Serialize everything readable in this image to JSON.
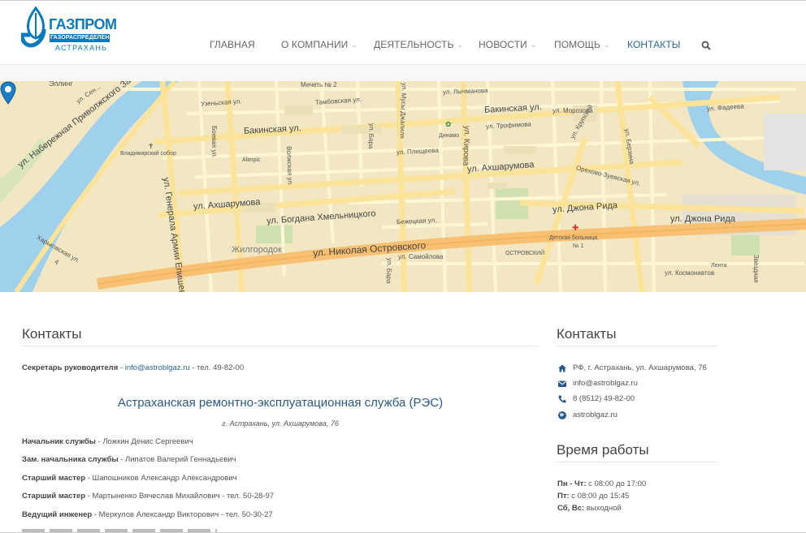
{
  "logo": {
    "word": "ГАЗПРОМ",
    "sub1": "ГАЗОРАСПРЕДЕЛЕНИЕ",
    "sub2": "АСТРАХАНЬ"
  },
  "nav": {
    "items": [
      {
        "label": "ГЛАВНАЯ",
        "dropdown": false
      },
      {
        "label": "О КОМПАНИИ",
        "dropdown": true
      },
      {
        "label": "ДЕЯТЕЛЬНОСТЬ",
        "dropdown": true
      },
      {
        "label": "НОВОСТИ",
        "dropdown": true
      },
      {
        "label": "ПОМОЩЬ",
        "dropdown": true
      },
      {
        "label": "КОНТАКТЫ",
        "dropdown": false,
        "active": true
      }
    ],
    "chevron": "⌄"
  },
  "map_labels": {
    "elling": "Эллинг",
    "naberezhnaya": "ул. Набережная Приволжского Зато...",
    "sen": "ул. Сен...",
    "vladimirsky": "Владимирский собор",
    "alimpic": "Alimpic",
    "borovaya": "Боевая ул.",
    "volzhskaya": "Волжская ул.",
    "uzenskaya": "Узеньская ул.",
    "mechet": "Мечеть № 2",
    "tambovskaya": "Тамбовская ул.",
    "musy": "ул. Мусы Джалиля",
    "lychmanova": "ул. Лычманова",
    "bakinskaya1": "Бакинская ул.",
    "bakinskaya2": "Бакинская ул.",
    "kirova": "ул. Кирова",
    "morozova": "ул. Морозова",
    "dinamo": "Динамо",
    "trofimova": "ул. Трофимова",
    "bara": "ул. Бара",
    "plescheeva": "ул. Плещеева",
    "akhsharumova1": "ул. Ахшарумова",
    "akhsharumova2": "ул. Ахшарумова",
    "khmelnitskogo": "ул. Богдана Хмельницкого",
    "bezhetskaya": "Бежецкая ул.",
    "zhilgorodok": "Жилгородок",
    "ostrovskogo": "ул. Николая Островского",
    "samoylova": "ул. Самойлова",
    "bara2": "ул. Бара",
    "krupskoy": "ул. Крупской",
    "berzina": "ул. Берзина",
    "orekhovo": "Орехово-Зуевская ул.",
    "dzhona1": "ул. Джона Рида",
    "dzhona2": "ул. Джона Рида",
    "bolnitsa": "Детская больница",
    "bolnitsa_n": "№ 1",
    "ostrovsky": "ОСТРОВСКИЙ",
    "lenta": "Лента",
    "kosmonavtov": "ул. Космонавтов",
    "fadeeva": "ул. Фадеева",
    "zvezdnaya": "Звездная",
    "kharkovskaya": "Харьковская ул.",
    "generala": "ул. Генерала Армии Епишева",
    "sorok": "4"
  },
  "contacts_main": {
    "heading": "Контакты",
    "secretary_role": "Секретарь руководителя",
    "secretary_sep": " - ",
    "secretary_email": "info@astroblgaz.ru",
    "secretary_phone": " - тел. 49-82-00",
    "res_title": "Астраханская ремонтно-эксплуатационная служба (РЭС)",
    "res_address": "г. Астрахань,  ул. Ахшарумова, 76",
    "staff": [
      {
        "role": "Начальник службы",
        "rest": " - Ложкин Денис Сергеевич"
      },
      {
        "role": "Зам. начальника службы",
        "rest": " - Липатов Валерий Геннадьевич"
      },
      {
        "role": "Старший мастер",
        "rest": " - Шапошников Александр Александрович"
      },
      {
        "role": "Старший мастер",
        "rest": " - Мартыненко Вячеслав Михайлович - тел. 50-28-97"
      },
      {
        "role": "Ведущий инженер",
        "rest": " - Меркулов Александр Викторович - тел. 50-30-27"
      }
    ]
  },
  "sidebar": {
    "contacts_heading": "Контакты",
    "items": [
      {
        "icon": "home-icon",
        "text": "РФ, г. Астрахань, ул. Ахшарумова, 76"
      },
      {
        "icon": "envelope-icon",
        "text": "info@astroblgaz.ru"
      },
      {
        "icon": "phone-icon",
        "text": "8 (8512) 49-82-00"
      },
      {
        "icon": "globe-icon",
        "text": "astroblgaz.ru"
      }
    ],
    "hours_heading": "Время работы",
    "hours": [
      {
        "days": "Пн - Чт:",
        "time": " с 08:00 до 17:00"
      },
      {
        "days": "Пт:",
        "time": " с 08:00 до 15:45"
      },
      {
        "days": "Сб, Вс:",
        "time": " выходной"
      }
    ]
  },
  "colors": {
    "accent": "#2a6496",
    "logo_blue": "#0a79bd",
    "map_bg": "#f2e7c2",
    "road": "#fbe39a",
    "river": "#9fd1ed"
  }
}
